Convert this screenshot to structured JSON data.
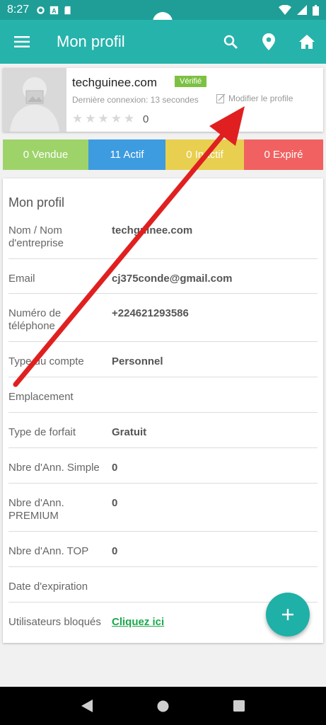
{
  "status": {
    "time": "8:27"
  },
  "appbar": {
    "title": "Mon profil"
  },
  "profile": {
    "name": "techguinee.com",
    "verified": "Vérifié",
    "last_login": "Dernière connexion: 13 secondes",
    "edit_label": "Modifier le profile",
    "rating": "0",
    "stars": 5
  },
  "stats": [
    {
      "label": "0 Vendue",
      "color": "#9ed36a"
    },
    {
      "label": "11 Actif",
      "color": "#3d9be0"
    },
    {
      "label": "0 Inactif",
      "color": "#e8cf50"
    },
    {
      "label": "0 Expiré",
      "color": "#f16161"
    }
  ],
  "details": {
    "heading": "Mon profil",
    "rows": [
      {
        "label": "Nom / Nom d'entreprise",
        "value": "techguinee.com"
      },
      {
        "label": "Email",
        "value": "cj375conde@gmail.com"
      },
      {
        "label": "Numéro de téléphone",
        "value": "+224621293586"
      },
      {
        "label": "Type du compte",
        "value": "Personnel"
      },
      {
        "label": "Emplacement",
        "value": ""
      },
      {
        "label": "Type de forfait",
        "value": "Gratuit"
      },
      {
        "label": "Nbre d'Ann. Simple",
        "value": "0"
      },
      {
        "label": "Nbre d'Ann. PREMIUM",
        "value": "0"
      },
      {
        "label": "Nbre d'Ann. TOP",
        "value": "0"
      },
      {
        "label": "Date d'expiration",
        "value": ""
      },
      {
        "label": "Utilisateurs bloqués",
        "value": "Cliquez ici"
      }
    ]
  },
  "colors": {
    "primary": "#26b3ab",
    "accent": "#1fb0a8",
    "arrow": "#e02020"
  }
}
